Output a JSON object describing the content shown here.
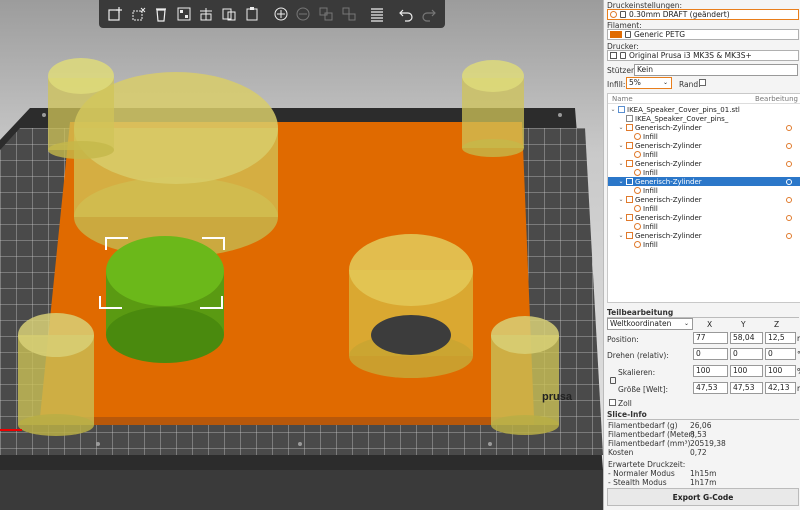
{
  "toolbar": {
    "buttons": [
      "add-icon",
      "delete-icon",
      "delete-all-icon",
      "arrange-icon",
      "copy-icon",
      "paste-icon",
      "add-instance-icon",
      "remove-instance-icon",
      "split-objects-icon",
      "split-parts-icon",
      "layers-icon",
      "undo-icon",
      "redo-icon"
    ]
  },
  "scene": {
    "bed_brand": "prusa"
  },
  "panel": {
    "print_settings_label": "Druckeinstellungen:",
    "print_settings_value": "0.30mm DRAFT (geändert)",
    "filament_label": "Filament:",
    "filament_value": "Generic PETG",
    "filament_color": "#e06a00",
    "printer_label": "Drucker:",
    "printer_value": "Original Prusa i3 MK3S & MK3S+",
    "supports_label": "Stützen:",
    "supports_value": "Kein",
    "infill_label": "Infill:",
    "infill_value": "5%",
    "brim_label": "Rand:",
    "tree": {
      "col_name": "Name",
      "col_edit": "Bearbeitung",
      "rows": [
        {
          "label": "IKEA_Speaker_Cover_pins_01.stl",
          "indent": 0,
          "chev": "v",
          "kind": "object"
        },
        {
          "label": "IKEA_Speaker_Cover_pins_",
          "indent": 1,
          "chev": "",
          "kind": "part"
        },
        {
          "label": "Generisch-Zylinder",
          "indent": 1,
          "chev": "v",
          "kind": "modifier"
        },
        {
          "label": "Infill",
          "indent": 2,
          "chev": "",
          "kind": "setting"
        },
        {
          "label": "Generisch-Zylinder",
          "indent": 1,
          "chev": "v",
          "kind": "modifier"
        },
        {
          "label": "Infill",
          "indent": 2,
          "chev": "",
          "kind": "setting"
        },
        {
          "label": "Generisch-Zylinder",
          "indent": 1,
          "chev": "v",
          "kind": "modifier"
        },
        {
          "label": "Infill",
          "indent": 2,
          "chev": "",
          "kind": "setting"
        },
        {
          "label": "Generisch-Zylinder",
          "indent": 1,
          "chev": "v",
          "kind": "modifier",
          "selected": true
        },
        {
          "label": "Infill",
          "indent": 2,
          "chev": "",
          "kind": "setting"
        },
        {
          "label": "Generisch-Zylinder",
          "indent": 1,
          "chev": "v",
          "kind": "modifier"
        },
        {
          "label": "Infill",
          "indent": 2,
          "chev": "",
          "kind": "setting"
        },
        {
          "label": "Generisch-Zylinder",
          "indent": 1,
          "chev": "v",
          "kind": "modifier"
        },
        {
          "label": "Infill",
          "indent": 2,
          "chev": "",
          "kind": "setting"
        },
        {
          "label": "Generisch-Zylinder",
          "indent": 1,
          "chev": "v",
          "kind": "modifier"
        },
        {
          "label": "Infill",
          "indent": 2,
          "chev": "",
          "kind": "setting"
        }
      ]
    },
    "part_edit": {
      "title": "Teilbearbeitung",
      "coord_value": "Weltkoordinaten",
      "axis_x": "X",
      "axis_y": "Y",
      "axis_z": "Z",
      "position_label": "Position:",
      "position": [
        "77",
        "58,04",
        "12,5"
      ],
      "position_unit": "mm",
      "rotation_label": "Drehen (relativ):",
      "rotation": [
        "0",
        "0",
        "0"
      ],
      "rotation_unit": "°",
      "scale_label": "Skalieren:",
      "scale": [
        "100",
        "100",
        "100"
      ],
      "scale_unit": "%",
      "size_label": "Größe [Welt]:",
      "size": [
        "47,53",
        "47,53",
        "42,13"
      ],
      "size_unit": "mm",
      "inch_label": "Zoll"
    },
    "slice_info": {
      "title": "Slice-Info",
      "rows": [
        {
          "label": "Filamentbedarf (g)",
          "value": "26,06"
        },
        {
          "label": "Filamentbedarf (Meter)",
          "value": "8,53"
        },
        {
          "label": "Filamentbedarf (mm³)",
          "value": "20519,38"
        },
        {
          "label": "Kosten",
          "value": "0,72"
        },
        {
          "label": "Erwartete Druckzeit:",
          "value": ""
        },
        {
          "label": "- Normaler Modus",
          "value": "1h15m"
        },
        {
          "label": "- Stealth Modus",
          "value": "1h17m"
        }
      ]
    },
    "export_label": "Export G-Code"
  }
}
